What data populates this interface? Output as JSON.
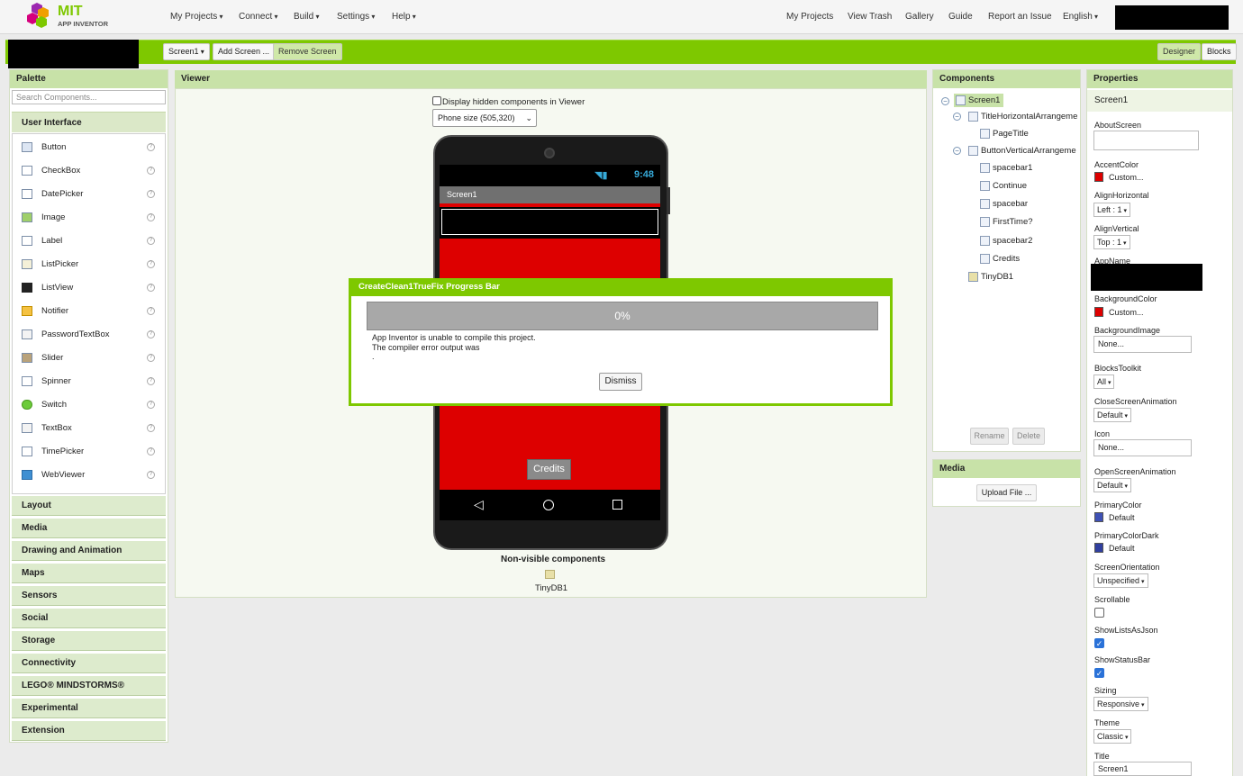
{
  "nav": {
    "logo_text": "MIT",
    "logo_sub": "APP INVENTOR",
    "left_menus": [
      "My Projects",
      "Connect",
      "Build",
      "Settings",
      "Help"
    ],
    "right_links": [
      "My Projects",
      "View Trash",
      "Gallery",
      "Guide",
      "Report an Issue"
    ],
    "language": "English"
  },
  "toolbar": {
    "screen_select": "Screen1",
    "add_screen": "Add Screen ...",
    "remove_screen": "Remove Screen",
    "designer": "Designer",
    "blocks": "Blocks"
  },
  "palette": {
    "title": "Palette",
    "search_placeholder": "Search Components...",
    "open_category": "User Interface",
    "items": [
      "Button",
      "CheckBox",
      "DatePicker",
      "Image",
      "Label",
      "ListPicker",
      "ListView",
      "Notifier",
      "PasswordTextBox",
      "Slider",
      "Spinner",
      "Switch",
      "TextBox",
      "TimePicker",
      "WebViewer"
    ],
    "help_glyph": "?",
    "categories": [
      "Layout",
      "Media",
      "Drawing and Animation",
      "Maps",
      "Sensors",
      "Social",
      "Storage",
      "Connectivity",
      "LEGO® MINDSTORMS®",
      "Experimental",
      "Extension"
    ]
  },
  "viewer": {
    "title": "Viewer",
    "hidden_checkbox_label": "Display hidden components in Viewer",
    "size_select": "Phone size (505,320)",
    "phone_time": "9:48",
    "screen_title": "Screen1",
    "credits_button": "Credits",
    "nonvisible_title": "Non-visible components",
    "nonvisible_item": "TinyDB1"
  },
  "components": {
    "title": "Components",
    "tree": [
      "Screen1",
      "TitleHorizontalArrangeme",
      "PageTitle",
      "ButtonVerticalArrangeme",
      "spacebar1",
      "Continue",
      "spacebar",
      "FirstTime?",
      "spacebar2",
      "Credits",
      "TinyDB1"
    ],
    "rename": "Rename",
    "delete": "Delete"
  },
  "media": {
    "title": "Media",
    "upload": "Upload File ..."
  },
  "properties": {
    "title": "Properties",
    "selected": "Screen1",
    "AboutScreen": "AboutScreen",
    "AccentColor": "AccentColor",
    "AccentColor_val": "Custom...",
    "AlignHorizontal": "AlignHorizontal",
    "AlignHorizontal_val": "Left : 1",
    "AlignVertical": "AlignVertical",
    "AlignVertical_val": "Top : 1",
    "AppName": "AppName",
    "BackgroundColor": "BackgroundColor",
    "BackgroundColor_val": "Custom...",
    "BackgroundImage": "BackgroundImage",
    "BackgroundImage_val": "None...",
    "BlocksToolkit": "BlocksToolkit",
    "BlocksToolkit_val": "All",
    "CloseScreenAnimation": "CloseScreenAnimation",
    "CloseScreenAnimation_val": "Default",
    "Icon": "Icon",
    "Icon_val": "None...",
    "OpenScreenAnimation": "OpenScreenAnimation",
    "OpenScreenAnimation_val": "Default",
    "PrimaryColor": "PrimaryColor",
    "PrimaryColor_val": "Default",
    "PrimaryColorDark": "PrimaryColorDark",
    "PrimaryColorDark_val": "Default",
    "ScreenOrientation": "ScreenOrientation",
    "ScreenOrientation_val": "Unspecified",
    "Scrollable": "Scrollable",
    "ShowListsAsJson": "ShowListsAsJson",
    "ShowStatusBar": "ShowStatusBar",
    "Sizing": "Sizing",
    "Sizing_val": "Responsive",
    "Theme": "Theme",
    "Theme_val": "Classic",
    "Title": "Title",
    "Title_val": "Screen1"
  },
  "dialog": {
    "title": "CreateClean1TrueFix Progress Bar",
    "progress": 0,
    "progress_label": "0%",
    "line1": "App Inventor is unable to compile this project.",
    "line2": "The compiler error output was",
    "line3": ".",
    "dismiss": "Dismiss"
  },
  "colors": {
    "accent_green": "#7ec800",
    "custom_red": "#dd0000",
    "primary_blue": "#3f51b5"
  }
}
